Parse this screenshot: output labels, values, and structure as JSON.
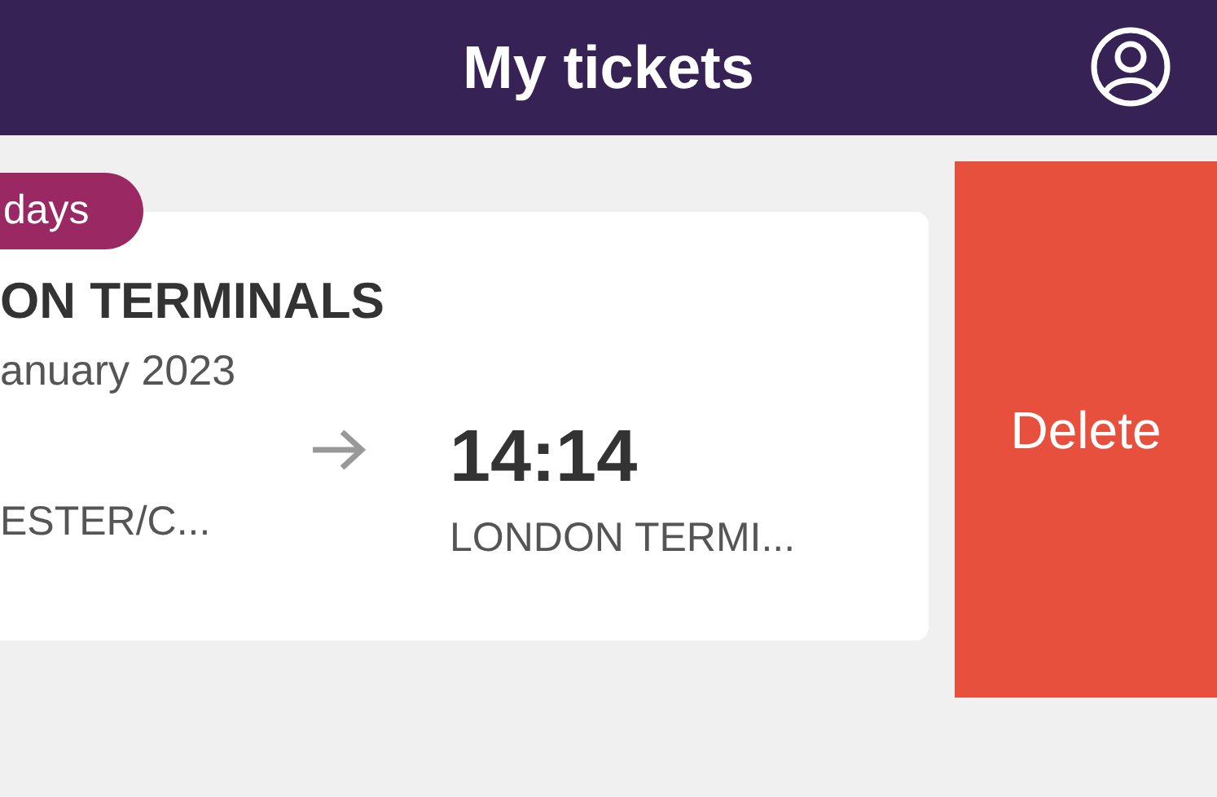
{
  "header": {
    "title": "My tickets"
  },
  "ticket": {
    "badge": "days",
    "destination": "ON TERMINALS",
    "date": "anuary 2023",
    "departure_station": "ESTER/C...",
    "arrival_time": "14:14",
    "arrival_station": "LONDON TERMI..."
  },
  "delete_action": {
    "label": "Delete"
  }
}
